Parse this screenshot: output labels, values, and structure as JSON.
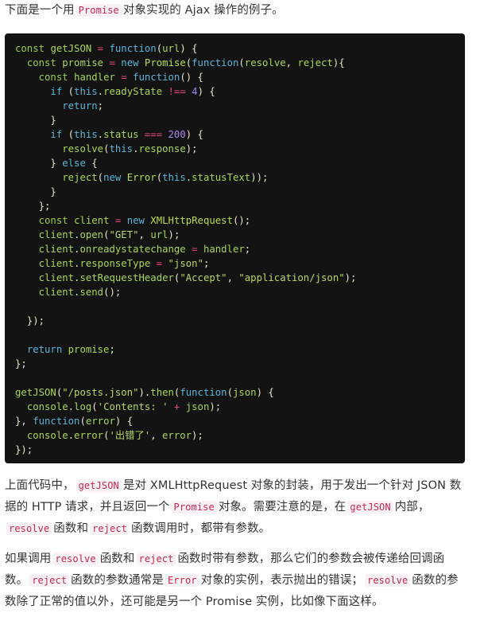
{
  "intro": {
    "segments": [
      {
        "type": "text",
        "value": "下面是一个用"
      },
      {
        "type": "code",
        "value": "Promise"
      },
      {
        "type": "text",
        "value": "对象实现的 Ajax 操作的例子。"
      }
    ]
  },
  "code_block": {
    "language": "javascript",
    "lines": [
      [
        [
          "kw",
          "const"
        ],
        [
          "pun",
          " "
        ],
        [
          "id",
          "getJSON"
        ],
        [
          "pun",
          " "
        ],
        [
          "op",
          "="
        ],
        [
          "pun",
          " "
        ],
        [
          "fn",
          "function"
        ],
        [
          "pun",
          "("
        ],
        [
          "id",
          "url"
        ],
        [
          "pun",
          ") {"
        ]
      ],
      [
        [
          "pun",
          "  "
        ],
        [
          "kw",
          "const"
        ],
        [
          "pun",
          " "
        ],
        [
          "id",
          "promise"
        ],
        [
          "pun",
          " "
        ],
        [
          "op",
          "="
        ],
        [
          "pun",
          " "
        ],
        [
          "fn",
          "new"
        ],
        [
          "pun",
          " "
        ],
        [
          "cls",
          "Promise"
        ],
        [
          "pun",
          "("
        ],
        [
          "fn",
          "function"
        ],
        [
          "pun",
          "("
        ],
        [
          "id",
          "resolve"
        ],
        [
          "pun",
          ", "
        ],
        [
          "id",
          "reject"
        ],
        [
          "pun",
          "){"
        ]
      ],
      [
        [
          "pun",
          "    "
        ],
        [
          "kw",
          "const"
        ],
        [
          "pun",
          " "
        ],
        [
          "id",
          "handler"
        ],
        [
          "pun",
          " "
        ],
        [
          "op",
          "="
        ],
        [
          "pun",
          " "
        ],
        [
          "fn",
          "function"
        ],
        [
          "pun",
          "() {"
        ]
      ],
      [
        [
          "pun",
          "      "
        ],
        [
          "fn",
          "if"
        ],
        [
          "pun",
          " ("
        ],
        [
          "fn",
          "this"
        ],
        [
          "pun",
          "."
        ],
        [
          "id",
          "readyState"
        ],
        [
          "pun",
          " "
        ],
        [
          "op",
          "!=="
        ],
        [
          "pun",
          " "
        ],
        [
          "num",
          "4"
        ],
        [
          "pun",
          ") {"
        ]
      ],
      [
        [
          "pun",
          "        "
        ],
        [
          "fn",
          "return"
        ],
        [
          "pun",
          ";"
        ]
      ],
      [
        [
          "pun",
          "      }"
        ]
      ],
      [
        [
          "pun",
          "      "
        ],
        [
          "fn",
          "if"
        ],
        [
          "pun",
          " ("
        ],
        [
          "fn",
          "this"
        ],
        [
          "pun",
          "."
        ],
        [
          "id",
          "status"
        ],
        [
          "pun",
          " "
        ],
        [
          "op",
          "==="
        ],
        [
          "pun",
          " "
        ],
        [
          "num",
          "200"
        ],
        [
          "pun",
          ") {"
        ]
      ],
      [
        [
          "pun",
          "        "
        ],
        [
          "id",
          "resolve"
        ],
        [
          "pun",
          "("
        ],
        [
          "fn",
          "this"
        ],
        [
          "pun",
          "."
        ],
        [
          "id",
          "response"
        ],
        [
          "pun",
          ");"
        ]
      ],
      [
        [
          "pun",
          "      } "
        ],
        [
          "fn",
          "else"
        ],
        [
          "pun",
          " {"
        ]
      ],
      [
        [
          "pun",
          "        "
        ],
        [
          "id",
          "reject"
        ],
        [
          "pun",
          "("
        ],
        [
          "fn",
          "new"
        ],
        [
          "pun",
          " "
        ],
        [
          "cls",
          "Error"
        ],
        [
          "pun",
          "("
        ],
        [
          "fn",
          "this"
        ],
        [
          "pun",
          "."
        ],
        [
          "id",
          "statusText"
        ],
        [
          "pun",
          "));"
        ]
      ],
      [
        [
          "pun",
          "      }"
        ]
      ],
      [
        [
          "pun",
          "    };"
        ]
      ],
      [
        [
          "pun",
          "    "
        ],
        [
          "kw",
          "const"
        ],
        [
          "pun",
          " "
        ],
        [
          "id",
          "client"
        ],
        [
          "pun",
          " "
        ],
        [
          "op",
          "="
        ],
        [
          "pun",
          " "
        ],
        [
          "fn",
          "new"
        ],
        [
          "pun",
          " "
        ],
        [
          "cls",
          "XMLHttpRequest"
        ],
        [
          "pun",
          "();"
        ]
      ],
      [
        [
          "pun",
          "    "
        ],
        [
          "id",
          "client"
        ],
        [
          "pun",
          "."
        ],
        [
          "id",
          "open"
        ],
        [
          "pun",
          "("
        ],
        [
          "str",
          "\"GET\""
        ],
        [
          "pun",
          ", "
        ],
        [
          "id",
          "url"
        ],
        [
          "pun",
          ");"
        ]
      ],
      [
        [
          "pun",
          "    "
        ],
        [
          "id",
          "client"
        ],
        [
          "pun",
          "."
        ],
        [
          "id",
          "onreadystatechange"
        ],
        [
          "pun",
          " "
        ],
        [
          "op",
          "="
        ],
        [
          "pun",
          " "
        ],
        [
          "id",
          "handler"
        ],
        [
          "pun",
          ";"
        ]
      ],
      [
        [
          "pun",
          "    "
        ],
        [
          "id",
          "client"
        ],
        [
          "pun",
          "."
        ],
        [
          "id",
          "responseType"
        ],
        [
          "pun",
          " "
        ],
        [
          "op",
          "="
        ],
        [
          "pun",
          " "
        ],
        [
          "str",
          "\"json\""
        ],
        [
          "pun",
          ";"
        ]
      ],
      [
        [
          "pun",
          "    "
        ],
        [
          "id",
          "client"
        ],
        [
          "pun",
          "."
        ],
        [
          "id",
          "setRequestHeader"
        ],
        [
          "pun",
          "("
        ],
        [
          "str",
          "\"Accept\""
        ],
        [
          "pun",
          ", "
        ],
        [
          "str",
          "\"application/json\""
        ],
        [
          "pun",
          ");"
        ]
      ],
      [
        [
          "pun",
          "    "
        ],
        [
          "id",
          "client"
        ],
        [
          "pun",
          "."
        ],
        [
          "id",
          "send"
        ],
        [
          "pun",
          "();"
        ]
      ],
      [
        [
          "pun",
          ""
        ]
      ],
      [
        [
          "pun",
          "  });"
        ]
      ],
      [
        [
          "pun",
          ""
        ]
      ],
      [
        [
          "pun",
          "  "
        ],
        [
          "fn",
          "return"
        ],
        [
          "pun",
          " "
        ],
        [
          "id",
          "promise"
        ],
        [
          "pun",
          ";"
        ]
      ],
      [
        [
          "pun",
          "};"
        ]
      ],
      [
        [
          "pun",
          ""
        ]
      ],
      [
        [
          "id",
          "getJSON"
        ],
        [
          "pun",
          "("
        ],
        [
          "str",
          "\"/posts.json\""
        ],
        [
          "pun",
          ")."
        ],
        [
          "id",
          "then"
        ],
        [
          "pun",
          "("
        ],
        [
          "fn",
          "function"
        ],
        [
          "pun",
          "("
        ],
        [
          "id",
          "json"
        ],
        [
          "pun",
          ") {"
        ]
      ],
      [
        [
          "pun",
          "  "
        ],
        [
          "id",
          "console"
        ],
        [
          "pun",
          "."
        ],
        [
          "id",
          "log"
        ],
        [
          "pun",
          "("
        ],
        [
          "str",
          "'Contents: '"
        ],
        [
          "pun",
          " "
        ],
        [
          "op",
          "+"
        ],
        [
          "pun",
          " "
        ],
        [
          "id",
          "json"
        ],
        [
          "pun",
          ");"
        ]
      ],
      [
        [
          "pun",
          "}, "
        ],
        [
          "fn",
          "function"
        ],
        [
          "pun",
          "("
        ],
        [
          "id",
          "error"
        ],
        [
          "pun",
          ") {"
        ]
      ],
      [
        [
          "pun",
          "  "
        ],
        [
          "id",
          "console"
        ],
        [
          "pun",
          "."
        ],
        [
          "id",
          "error"
        ],
        [
          "pun",
          "("
        ],
        [
          "str",
          "'出错了'"
        ],
        [
          "pun",
          ", "
        ],
        [
          "id",
          "error"
        ],
        [
          "pun",
          ");"
        ]
      ],
      [
        [
          "pun",
          "});"
        ]
      ]
    ]
  },
  "para1": {
    "segments": [
      {
        "type": "text",
        "value": "上面代码中，"
      },
      {
        "type": "code",
        "value": "getJSON"
      },
      {
        "type": "text",
        "value": "是对 XMLHttpRequest 对象的封装，用于发出一个针对 JSON 数据的 HTTP 请求，并且返回一个"
      },
      {
        "type": "code",
        "value": "Promise"
      },
      {
        "type": "text",
        "value": "对象。需要注意的是，在"
      },
      {
        "type": "code",
        "value": "getJSON"
      },
      {
        "type": "text",
        "value": "内部，"
      },
      {
        "type": "code",
        "value": "resolve"
      },
      {
        "type": "text",
        "value": "函数和"
      },
      {
        "type": "code",
        "value": "reject"
      },
      {
        "type": "text",
        "value": "函数调用时，都带有参数。"
      }
    ]
  },
  "para2": {
    "segments": [
      {
        "type": "text",
        "value": "如果调用"
      },
      {
        "type": "code",
        "value": "resolve"
      },
      {
        "type": "text",
        "value": "函数和"
      },
      {
        "type": "code",
        "value": "reject"
      },
      {
        "type": "text",
        "value": "函数时带有参数，那么它们的参数会被传递给回调函数。"
      },
      {
        "type": "code",
        "value": "reject"
      },
      {
        "type": "text",
        "value": "函数的参数通常是"
      },
      {
        "type": "code",
        "value": "Error"
      },
      {
        "type": "text",
        "value": "对象的实例，表示抛出的错误；"
      },
      {
        "type": "code",
        "value": "resolve"
      },
      {
        "type": "text",
        "value": "函数的参数除了正常的值以外，还可能是另一个 Promise 实例，比如像下面这样。"
      }
    ]
  }
}
